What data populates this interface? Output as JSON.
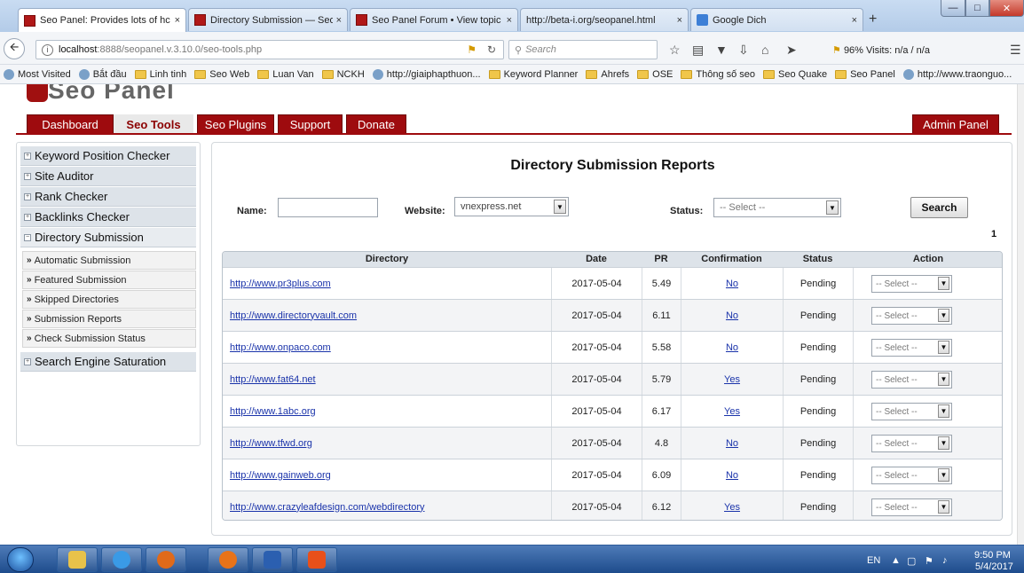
{
  "browser": {
    "tabs": [
      {
        "title": "Seo Panel: Provides lots of hc",
        "active": true,
        "favicon": "seo-panel-icon"
      },
      {
        "title": "Directory Submission — Seo",
        "active": false,
        "favicon": "seo-panel-icon"
      },
      {
        "title": "Seo Panel Forum • View topic",
        "active": false,
        "favicon": "seo-panel-icon"
      },
      {
        "title": "http://beta-i.org/seopanel.html",
        "active": false,
        "favicon": "none"
      },
      {
        "title": "Google Dich",
        "active": false,
        "favicon": "google-translate-icon"
      }
    ],
    "close_glyph": "×",
    "new_tab": "+",
    "url_host": "localhost",
    "url_path": ":8888/seopanel.v.3.10.0/seo-tools.php",
    "search_placeholder": "Search",
    "stats_text": "96%  Visits: n/a / n/a",
    "bookmarks": [
      {
        "label": "Most Visited",
        "icon": "firefox-icon"
      },
      {
        "label": "Bắt đầu",
        "icon": "globe-icon"
      },
      {
        "label": "Linh tinh",
        "icon": "folder-icon"
      },
      {
        "label": "Seo Web",
        "icon": "folder-icon"
      },
      {
        "label": "Luan Van",
        "icon": "folder-icon"
      },
      {
        "label": "NCKH",
        "icon": "folder-icon"
      },
      {
        "label": "http://giaiphapthuon...",
        "icon": "globe-icon"
      },
      {
        "label": "Keyword Planner",
        "icon": "folder-icon"
      },
      {
        "label": "Ahrefs",
        "icon": "folder-icon"
      },
      {
        "label": "OSE",
        "icon": "folder-icon"
      },
      {
        "label": "Thông số seo",
        "icon": "folder-icon"
      },
      {
        "label": "Seo Quake",
        "icon": "folder-icon"
      },
      {
        "label": "Seo Panel",
        "icon": "folder-icon"
      },
      {
        "label": "http://www.traonguo...",
        "icon": "dictionary-icon"
      }
    ]
  },
  "app": {
    "logo": "Seo Panel",
    "nav": {
      "dashboard": "Dashboard",
      "seo_tools": "Seo Tools",
      "seo_plugins": "Seo Plugins",
      "support": "Support",
      "donate": "Donate",
      "admin_panel": "Admin Panel"
    },
    "sidebar": {
      "keyword_position": "Keyword Position Checker",
      "site_auditor": "Site Auditor",
      "rank_checker": "Rank Checker",
      "backlinks": "Backlinks Checker",
      "directory_submission": "Directory Submission",
      "sub_items": [
        "Automatic Submission",
        "Featured Submission",
        "Skipped Directories",
        "Submission Reports",
        "Check Submission Status"
      ],
      "search_engine_saturation": "Search Engine Saturation"
    },
    "report": {
      "title": "Directory Submission Reports",
      "name_label": "Name:",
      "name_value": "",
      "website_label": "Website:",
      "website_value": "vnexpress.net",
      "status_label": "Status:",
      "status_value": "-- Select --",
      "search_button": "Search",
      "page_number": "1",
      "columns": {
        "directory": "Directory",
        "date": "Date",
        "pr": "PR",
        "confirmation": "Confirmation",
        "status": "Status",
        "action": "Action"
      },
      "action_select": "-- Select --",
      "rows": [
        {
          "directory": "http://www.pr3plus.com",
          "date": "2017-05-04",
          "pr": "5.49",
          "confirmation": "No",
          "status": "Pending"
        },
        {
          "directory": "http://www.directoryvault.com",
          "date": "2017-05-04",
          "pr": "6.11",
          "confirmation": "No",
          "status": "Pending"
        },
        {
          "directory": "http://www.onpaco.com",
          "date": "2017-05-04",
          "pr": "5.58",
          "confirmation": "No",
          "status": "Pending"
        },
        {
          "directory": "http://www.fat64.net",
          "date": "2017-05-04",
          "pr": "5.79",
          "confirmation": "Yes",
          "status": "Pending"
        },
        {
          "directory": "http://www.1abc.org",
          "date": "2017-05-04",
          "pr": "6.17",
          "confirmation": "Yes",
          "status": "Pending"
        },
        {
          "directory": "http://www.tfwd.org",
          "date": "2017-05-04",
          "pr": "4.8",
          "confirmation": "No",
          "status": "Pending"
        },
        {
          "directory": "http://www.gainweb.org",
          "date": "2017-05-04",
          "pr": "6.09",
          "confirmation": "No",
          "status": "Pending"
        },
        {
          "directory": "http://www.crazyleafdesign.com/webdirectory",
          "date": "2017-05-04",
          "pr": "6.12",
          "confirmation": "Yes",
          "status": "Pending"
        }
      ]
    }
  },
  "taskbar": {
    "apps": [
      "explorer-icon",
      "internet-explorer-icon",
      "media-player-icon",
      "firefox-icon",
      "word-icon",
      "xampp-icon"
    ],
    "lang": "EN",
    "time": "9:50 PM",
    "date": "5/4/2017"
  },
  "colors": {
    "brand_red": "#9e0b0e",
    "link_blue": "#1a33aa",
    "taskbar": "#1e4c8c"
  }
}
